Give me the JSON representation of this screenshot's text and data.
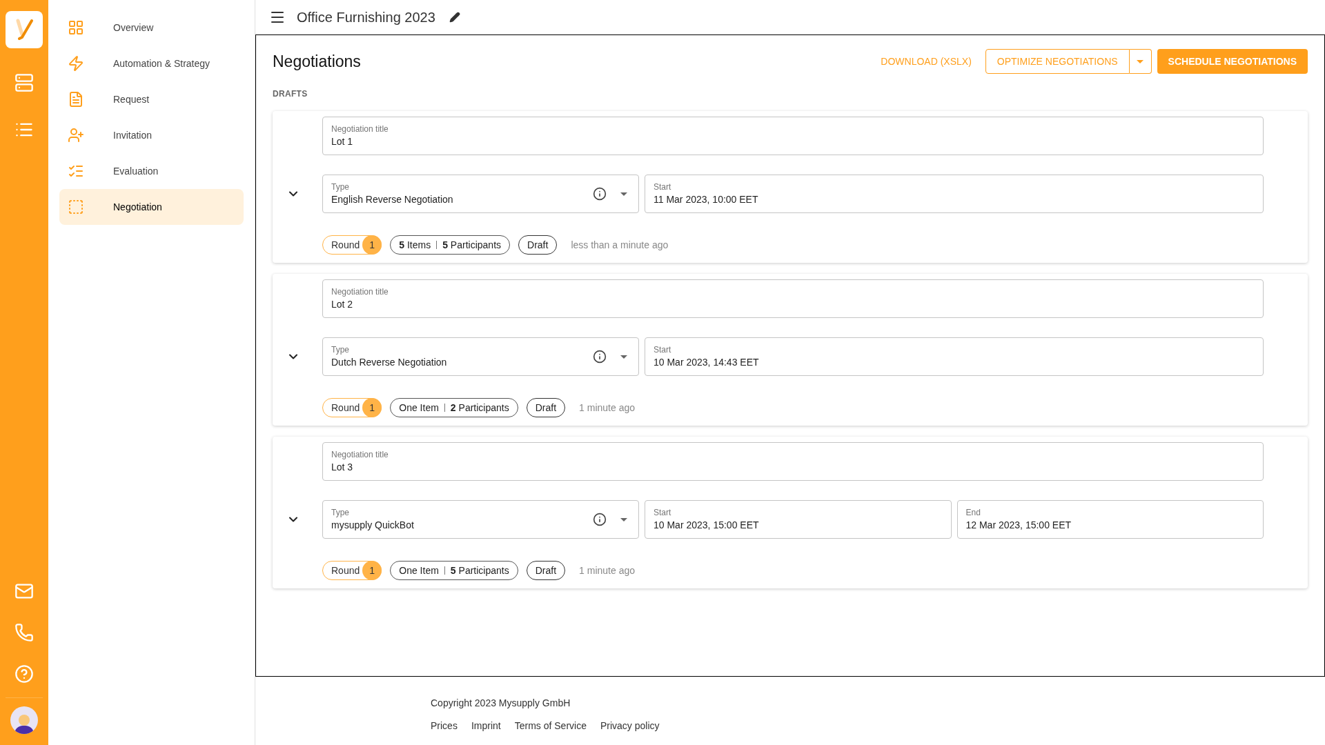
{
  "header": {
    "title": "Office Furnishing 2023"
  },
  "nav": [
    {
      "label": "Overview",
      "selected": false
    },
    {
      "label": "Automation & Strategy",
      "selected": false
    },
    {
      "label": "Request",
      "selected": false
    },
    {
      "label": "Invitation",
      "selected": false
    },
    {
      "label": "Evaluation",
      "selected": false
    },
    {
      "label": "Negotiation",
      "selected": true
    }
  ],
  "page": {
    "title": "Negotiations",
    "actions": [
      {
        "kind": "text",
        "label": "DOWNLOAD (XSLX)"
      },
      {
        "kind": "split",
        "label": "OPTIMIZE NEGOTIATIONS"
      },
      {
        "kind": "filled",
        "label": "SCHEDULE NEGOTIATIONS"
      }
    ],
    "section": "DRAFTS"
  },
  "drafts": [
    {
      "title_label": "Negotiation title",
      "title": "Lot 1",
      "type_label": "Type",
      "type": "English Reverse Negotiation",
      "dates": [
        {
          "label": "Start",
          "value": "11 Mar 2023, 10:00 EET"
        }
      ],
      "round_label": "Round",
      "round": "1",
      "items": "**5** Items",
      "participants": "**5** Participants",
      "status": "Draft",
      "time": "less than a minute ago"
    },
    {
      "title_label": "Negotiation title",
      "title": "Lot 2",
      "type_label": "Type",
      "type": "Dutch Reverse Negotiation",
      "dates": [
        {
          "label": "Start",
          "value": "10 Mar 2023, 14:43 EET"
        }
      ],
      "round_label": "Round",
      "round": "1",
      "items": "One Item",
      "participants": "**2** Participants",
      "status": "Draft",
      "time": "1 minute ago"
    },
    {
      "title_label": "Negotiation title",
      "title": "Lot 3",
      "type_label": "Type",
      "type": "mysupply QuickBot",
      "dates": [
        {
          "label": "Start",
          "value": "10 Mar 2023, 15:00 EET"
        },
        {
          "label": "End",
          "value": "12 Mar 2023, 15:00 EET"
        }
      ],
      "round_label": "Round",
      "round": "1",
      "items": "One Item",
      "participants": "**5** Participants",
      "status": "Draft",
      "time": "1 minute ago"
    }
  ],
  "footer": {
    "copyright": "Copyright 2023 Mysupply GmbH",
    "links": [
      "Prices",
      "Imprint",
      "Terms of Service",
      "Privacy policy"
    ]
  }
}
